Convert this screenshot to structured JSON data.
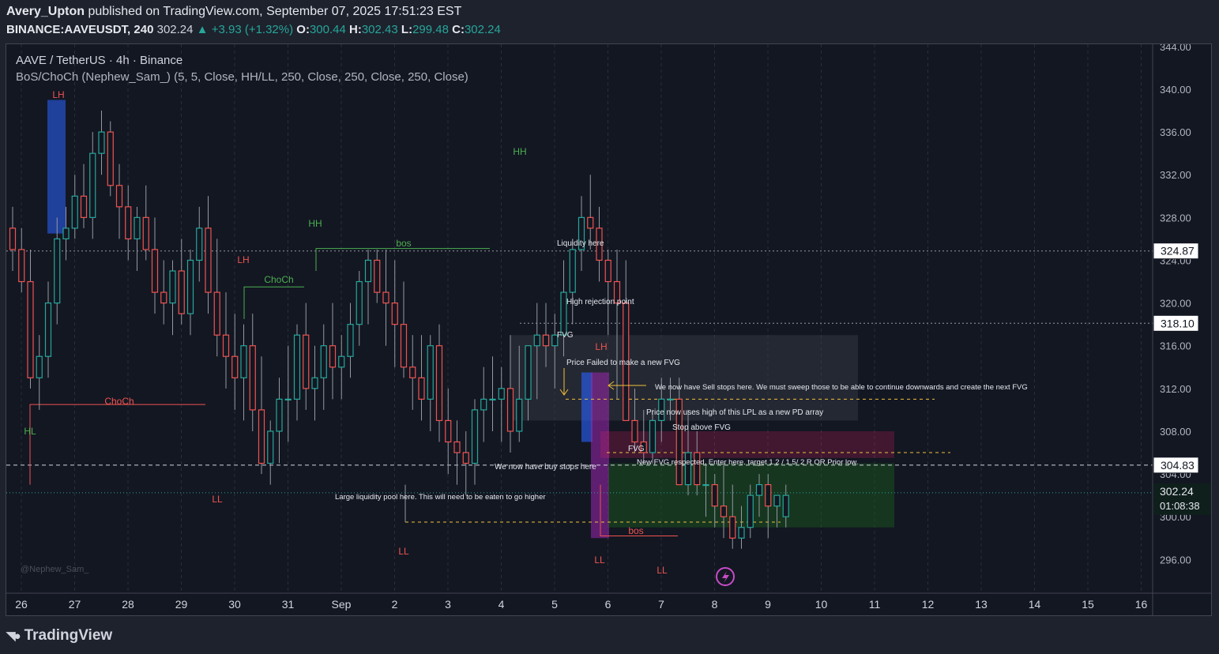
{
  "header": {
    "author": "Avery_Upton",
    "published": "published on TradingView.com, September 07, 2025 17:51:23 EST",
    "symbol": "BINANCE:AAVEUSDT, 240",
    "last": "302.24",
    "change": "+3.93 (+1.32%)",
    "o_label": "O:",
    "o": "300.44",
    "h_label": "H:",
    "h": "302.43",
    "l_label": "L:",
    "l": "299.48",
    "c_label": "C:",
    "c": "302.24"
  },
  "legend": {
    "title": "AAVE / TetherUS · 4h · Binance",
    "indicator": "BoS/ChoCh (Nephew_Sam_) (5, 5, Close, HH/LL, 250, Close, 250, Close, 250, Close)"
  },
  "watermark": "@Nephew_Sam_",
  "footer": {
    "brand": "TradingView"
  },
  "colors": {
    "up": "#26a69a",
    "down": "#ef5350",
    "bg": "#131722",
    "grid": "#2a2e39"
  },
  "chart_data": {
    "type": "candlestick",
    "y_ticks": [
      "344.00",
      "340.00",
      "336.00",
      "332.00",
      "328.00",
      "324.00",
      "320.00",
      "316.00",
      "312.00",
      "308.00",
      "304.00",
      "300.00",
      "296.00"
    ],
    "x_ticks": [
      "26",
      "27",
      "28",
      "29",
      "30",
      "31",
      "Sep",
      "2",
      "3",
      "4",
      "5",
      "6",
      "7",
      "8",
      "9",
      "10",
      "11",
      "12",
      "13",
      "14",
      "15",
      "16"
    ],
    "price_labels": [
      {
        "value": "324.87",
        "price": 324.87
      },
      {
        "value": "318.10",
        "price": 318.1
      },
      {
        "value": "304.83",
        "price": 304.83
      }
    ],
    "current": {
      "value": "302.24",
      "countdown": "01:08:38",
      "price": 302.24
    },
    "candles": [
      [
        327,
        329,
        323,
        325
      ],
      [
        325,
        327,
        321,
        322
      ],
      [
        322,
        325,
        312,
        313
      ],
      [
        313,
        317,
        310,
        315
      ],
      [
        315,
        322,
        313,
        320
      ],
      [
        320,
        328,
        318,
        326
      ],
      [
        326,
        329,
        324,
        327
      ],
      [
        327,
        332,
        326,
        330
      ],
      [
        330,
        333,
        327,
        328
      ],
      [
        328,
        336,
        326,
        334
      ],
      [
        334,
        338,
        332,
        336
      ],
      [
        336,
        337,
        330,
        331
      ],
      [
        331,
        333,
        326,
        329
      ],
      [
        329,
        331,
        324,
        326
      ],
      [
        326,
        329,
        323,
        328
      ],
      [
        328,
        331,
        324,
        325
      ],
      [
        325,
        328,
        319,
        321
      ],
      [
        321,
        324,
        318,
        320
      ],
      [
        320,
        324,
        317,
        323
      ],
      [
        323,
        326,
        318,
        319
      ],
      [
        319,
        325,
        317,
        324
      ],
      [
        324,
        329,
        322,
        327
      ],
      [
        327,
        330,
        319,
        321
      ],
      [
        321,
        326,
        315,
        317
      ],
      [
        317,
        321,
        312,
        315
      ],
      [
        315,
        319,
        310,
        313
      ],
      [
        313,
        318,
        309,
        316
      ],
      [
        316,
        319,
        308,
        310
      ],
      [
        310,
        315,
        304,
        305
      ],
      [
        305,
        309,
        303,
        308
      ],
      [
        308,
        313,
        305,
        311
      ],
      [
        311,
        316,
        307,
        311
      ],
      [
        311,
        318,
        309,
        317
      ],
      [
        317,
        320,
        310,
        312
      ],
      [
        312,
        316,
        309,
        313
      ],
      [
        313,
        318,
        310,
        316
      ],
      [
        316,
        320,
        311,
        314
      ],
      [
        314,
        317,
        311,
        315
      ],
      [
        315,
        320,
        313,
        318
      ],
      [
        318,
        323,
        316,
        322
      ],
      [
        322,
        325,
        318,
        324
      ],
      [
        324,
        325,
        320,
        321
      ],
      [
        321,
        325,
        316,
        320
      ],
      [
        320,
        324,
        314,
        318
      ],
      [
        318,
        322,
        313,
        314
      ],
      [
        314,
        317,
        310,
        313
      ],
      [
        313,
        317,
        309,
        311
      ],
      [
        311,
        317,
        308,
        316
      ],
      [
        316,
        318,
        307,
        309
      ],
      [
        309,
        312,
        304,
        307
      ],
      [
        307,
        309,
        303,
        306
      ],
      [
        306,
        308,
        302,
        305
      ],
      [
        305,
        311,
        303,
        310
      ],
      [
        310,
        314,
        307,
        311
      ],
      [
        311,
        315,
        308,
        311
      ],
      [
        311,
        314,
        307,
        312
      ],
      [
        312,
        317,
        306,
        308
      ],
      [
        308,
        316,
        307,
        311
      ],
      [
        311,
        316,
        309,
        316
      ],
      [
        316,
        320,
        311,
        317
      ],
      [
        317,
        320,
        314,
        316
      ],
      [
        316,
        319,
        312,
        317
      ],
      [
        317,
        324,
        315,
        321
      ],
      [
        321,
        326,
        318,
        325
      ],
      [
        325,
        330,
        323,
        328
      ],
      [
        328,
        332,
        325,
        327
      ],
      [
        327,
        329,
        322,
        324
      ],
      [
        324,
        325,
        317,
        322
      ],
      [
        322,
        325,
        311,
        320
      ],
      [
        320,
        324,
        314,
        309
      ],
      [
        309,
        312,
        306,
        307
      ],
      [
        307,
        310,
        305,
        306
      ],
      [
        306,
        310,
        305,
        309
      ],
      [
        309,
        313,
        307,
        311
      ],
      [
        311,
        313,
        309,
        311
      ],
      [
        311,
        313,
        303,
        303
      ],
      [
        303,
        310,
        302,
        306
      ],
      [
        306,
        308,
        302,
        303
      ],
      [
        303,
        305,
        300,
        303
      ],
      [
        303,
        304,
        299,
        301
      ],
      [
        301,
        305,
        298,
        300
      ],
      [
        300,
        303,
        297,
        298
      ],
      [
        298,
        301,
        297,
        299
      ],
      [
        299,
        303,
        298,
        302
      ],
      [
        302,
        304,
        300,
        303
      ],
      [
        303,
        304,
        298,
        301
      ],
      [
        301,
        302,
        299,
        302
      ],
      [
        300,
        303,
        299,
        302
      ]
    ]
  },
  "annotations": {
    "hh_1": "HH",
    "hh_2": "HH",
    "lh_1": "LH",
    "lh_2": "LH",
    "lh_3": "LH",
    "hl_1": "HL",
    "ll_1": "LL",
    "ll_2": "LL",
    "ll_3": "LL",
    "ll_4": "LL",
    "choch_1": "ChoCh",
    "choch_2": "ChoCh",
    "bos_1": "bos",
    "bos_2": "bos",
    "liquidity_here": "Liquidity here",
    "high_rejection": "High rejection point",
    "fvg_1": "FVG",
    "fvg_2": "FVG",
    "price_failed": "Price Failed to make a new FVG",
    "sell_stops": "We now have Sell stops here. We must sweep those to be able to continue downwards and create the next FVG",
    "lpl_array": "Price now uses high of this LPL as a new PD array",
    "stop_above": "Stop above FVG",
    "new_fvg": "New FVG respected. Enter here. target 1.2 / 1.5/ 2 R OR Prior low.",
    "buy_stops": "We now have buy stops here",
    "large_pool": "Large liquidity pool here. This will need to be eaten to go higher"
  }
}
